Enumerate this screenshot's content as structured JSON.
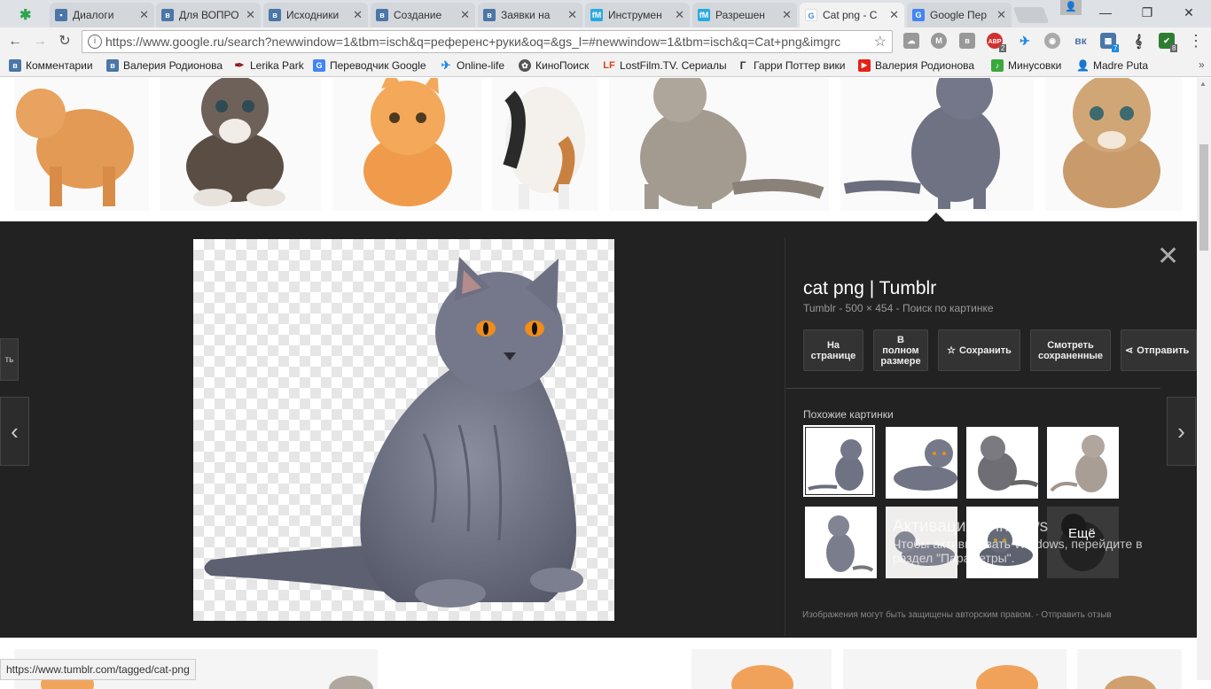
{
  "tabs": [
    {
      "title": "Диалоги",
      "icon": "chat-icon",
      "color": "#4a76a8"
    },
    {
      "title": "Для ВОПРО",
      "icon": "vk-icon",
      "color": "#4a76a8"
    },
    {
      "title": "Исходники",
      "icon": "vk-icon",
      "color": "#4a76a8"
    },
    {
      "title": "Создание",
      "icon": "vk-icon",
      "color": "#4a76a8"
    },
    {
      "title": "Заявки на",
      "icon": "vk-icon",
      "color": "#4a76a8"
    },
    {
      "title": "Инструмен",
      "icon": "fm-icon",
      "color": "#29a9e1"
    },
    {
      "title": "Разрешен",
      "icon": "fm-icon",
      "color": "#29a9e1"
    },
    {
      "title": "Cat png - C",
      "icon": "google-icon",
      "color": "#4285f4"
    },
    {
      "title": "Google Пер",
      "icon": "google-translate-icon",
      "color": "#4285f4"
    }
  ],
  "address": {
    "url": "https://www.google.ru/search?newwindow=1&tbm=isch&q=референс+руки&oq=&gs_l=#newwindow=1&tbm=isch&q=Cat+png&imgrc"
  },
  "bookmarks": [
    {
      "label": "Комментарии",
      "icon": "vk-icon",
      "color": "#4a76a8"
    },
    {
      "label": "Валерия Родионова",
      "icon": "vk-icon",
      "color": "#4a76a8"
    },
    {
      "label": "Lerika Park",
      "icon": "feather-icon",
      "color": "#8b1a1a"
    },
    {
      "label": "Переводчик Google",
      "icon": "google-translate-icon",
      "color": "#4285f4"
    },
    {
      "label": "Online-life",
      "icon": "bird-icon",
      "color": "#1e88e5"
    },
    {
      "label": "КиноПоиск",
      "icon": "film-reel-icon",
      "color": "#555555"
    },
    {
      "label": "LostFilm.TV. Сериалы",
      "icon": "lostfilm-icon",
      "color": "#d84315"
    },
    {
      "label": "Гарри Поттер вики",
      "icon": "wiki-icon",
      "color": "#333333"
    },
    {
      "label": "Валерия Родионова",
      "icon": "youtube-icon",
      "color": "#e62117"
    },
    {
      "label": "Минусовки",
      "icon": "music-icon",
      "color": "#3ba83b"
    },
    {
      "label": "Madre Puta",
      "icon": "person-icon",
      "color": "#1a237e"
    }
  ],
  "extension_badges": {
    "abp": "ABP",
    "abp_count": "2",
    "vk_count": "7",
    "shield_count": "8"
  },
  "preview": {
    "title": "cat png | Tumblr",
    "subtitle": "Tumblr - 500 × 454 - Поиск по картинке",
    "buttons": {
      "visit_line1": "На",
      "visit_line2": "странице",
      "full_line1": "В",
      "full_line2": "полном",
      "full_line3": "размере",
      "save": "Сохранить",
      "saved_line1": "Смотреть",
      "saved_line2": "сохраненные",
      "share": "Отправить"
    },
    "side_tab": "ть",
    "similar_label": "Похожие картинки",
    "more": "Ещё",
    "footnote": "Изображения могут быть защищены авторским правом.  -  Отправить отзыв"
  },
  "watermark": {
    "line1": "Активация Windows",
    "line2": "Чтобы активировать Windows, перейдите в",
    "line3": "раздел \"Параметры\"."
  },
  "status_url": "https://www.tumblr.com/tagged/cat-png",
  "colors": {
    "panel": "#222222",
    "toolbar": "#f2f2f2",
    "accent_orange": "#f08c1a",
    "gray_cat": "#6e7283"
  }
}
